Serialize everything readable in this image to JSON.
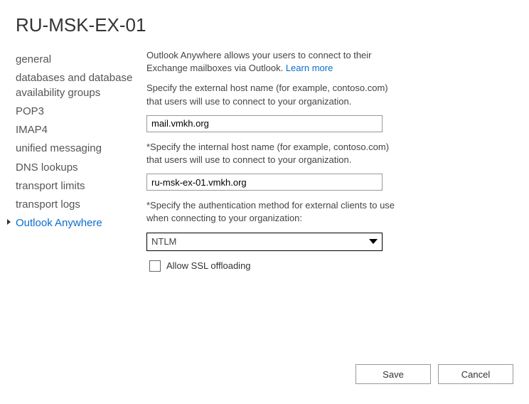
{
  "title": "RU-MSK-EX-01",
  "sidebar": {
    "items": [
      {
        "label": "general"
      },
      {
        "label": "databases and database availability groups"
      },
      {
        "label": "POP3"
      },
      {
        "label": "IMAP4"
      },
      {
        "label": "unified messaging"
      },
      {
        "label": "DNS lookups"
      },
      {
        "label": "transport limits"
      },
      {
        "label": "transport logs"
      },
      {
        "label": "Outlook Anywhere"
      }
    ]
  },
  "content": {
    "intro": "Outlook Anywhere allows your users to connect to their Exchange mailboxes via Outlook. ",
    "learn_more": "Learn more",
    "external_label": "Specify the external host name (for example, contoso.com) that users will use to connect to your organization.",
    "external_value": "mail.vmkh.org",
    "internal_label": "*Specify the internal host name (for example, contoso.com) that users will use to connect to your organization.",
    "internal_value": "ru-msk-ex-01.vmkh.org",
    "auth_label": "*Specify the authentication method for external clients to use when connecting to your organization:",
    "auth_value": "NTLM",
    "ssl_label": "Allow SSL offloading"
  },
  "footer": {
    "save": "Save",
    "cancel": "Cancel"
  }
}
